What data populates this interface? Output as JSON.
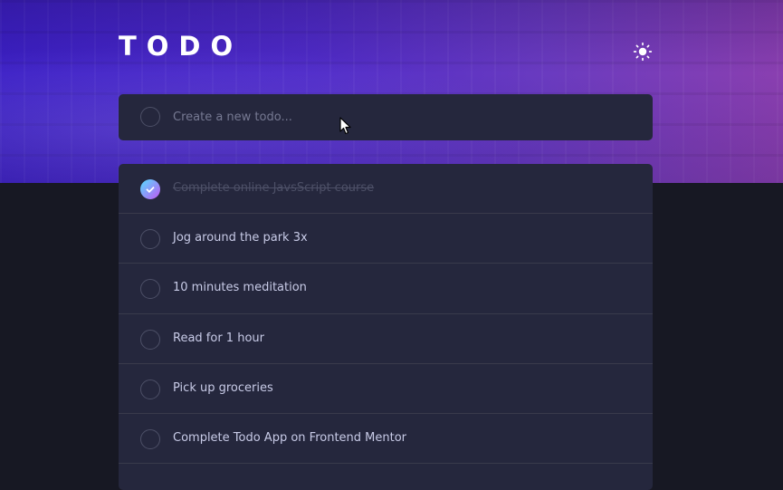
{
  "app": {
    "title": "TODO",
    "theme_toggle_icon": "sun-icon"
  },
  "new_todo": {
    "placeholder": "Create a new todo...",
    "value": ""
  },
  "todos": [
    {
      "label": "Complete online JavsScript course",
      "completed": true
    },
    {
      "label": "Jog around the park 3x",
      "completed": false
    },
    {
      "label": "10 minutes meditation",
      "completed": false
    },
    {
      "label": "Read for 1 hour",
      "completed": false
    },
    {
      "label": "Pick up groceries",
      "completed": false
    },
    {
      "label": "Complete Todo App on Frontend Mentor",
      "completed": false
    }
  ],
  "colors": {
    "background": "#171823",
    "card": "#25273d",
    "check_gradient_start": "#55ddff",
    "check_gradient_end": "#c058f3"
  }
}
